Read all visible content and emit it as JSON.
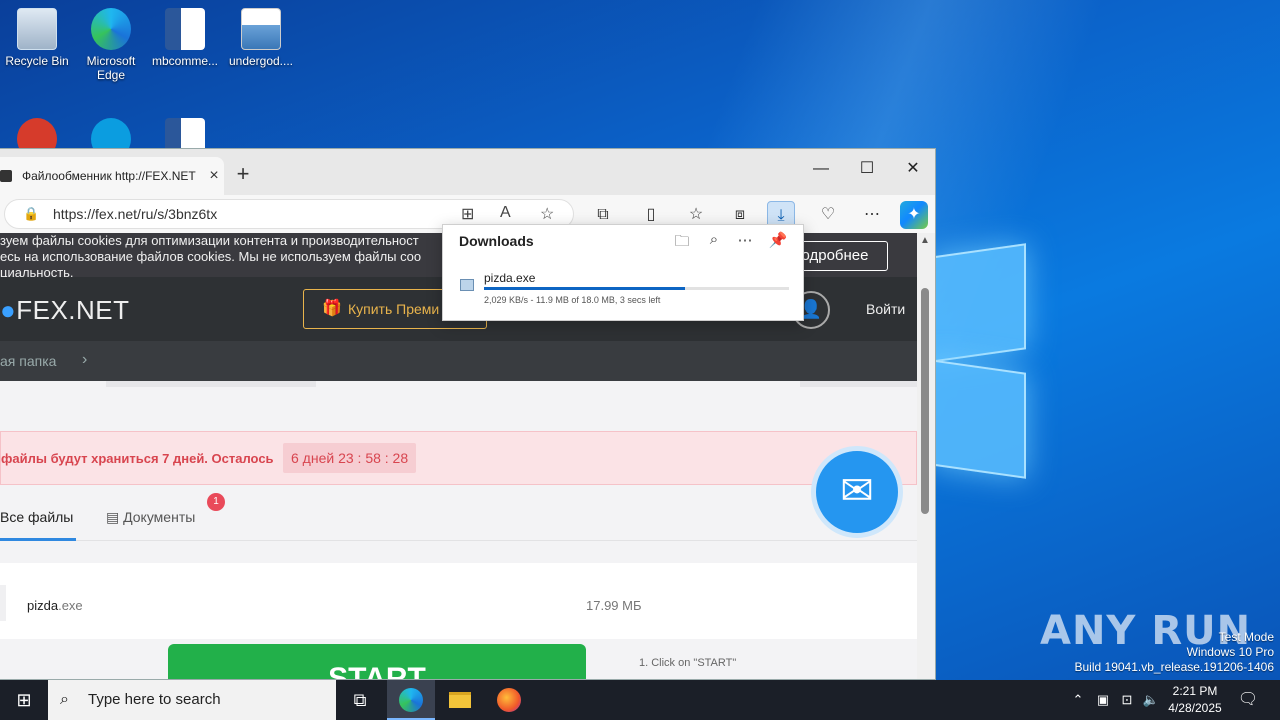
{
  "desktop": {
    "icons": [
      {
        "label": "Recycle Bin"
      },
      {
        "label": "Microsoft Edge"
      },
      {
        "label": "mbcomme..."
      },
      {
        "label": "undergod...."
      }
    ],
    "watermark": "ANY RUN",
    "test_mode": {
      "line1": "Test Mode",
      "line2": "Windows 10 Pro",
      "line3": "Build 19041.vb_release.191206-1406"
    }
  },
  "browser": {
    "tab_title": "Файлообменник http://FEX.NET",
    "url": "https://fex.net/ru/s/3bnz6tx",
    "downloads": {
      "title": "Downloads",
      "file_name": "pizda.exe",
      "progress": 0.66,
      "meta": "2,029 KB/s - 11.9 MB of 18.0 MB, 3 secs left"
    }
  },
  "page": {
    "cookie_line1": "зуем файлы cookies для оптимизации контента и производительност",
    "cookie_line2": "есь на использование файлов cookies. Мы не используем файлы coo",
    "cookie_line3": "циальность.",
    "cookie_more": "одробнее",
    "logo": "FEX.NET",
    "premium": "Купить Преми",
    "login": "Войти",
    "breadcrumb": "ая папка",
    "notice_text": "файлы будут храниться 7 дней. Осталось",
    "timer": "6 дней  23 : 58 : 28",
    "tab_all": "Все файлы",
    "tab_docs": "Документы",
    "docs_badge": "1",
    "file_name": "pizda",
    "file_ext": ".exe",
    "file_size": "17.99 МБ",
    "start_label": "START",
    "hint": "1. Click on \"START\""
  },
  "taskbar": {
    "search_placeholder": "Type here to search",
    "time": "2:21 PM",
    "date": "4/28/2025"
  },
  "colors": {
    "accent": "#0d65c3",
    "start_button": "#22b04a",
    "notice": "#d8454f",
    "premium": "#e9b44c"
  }
}
